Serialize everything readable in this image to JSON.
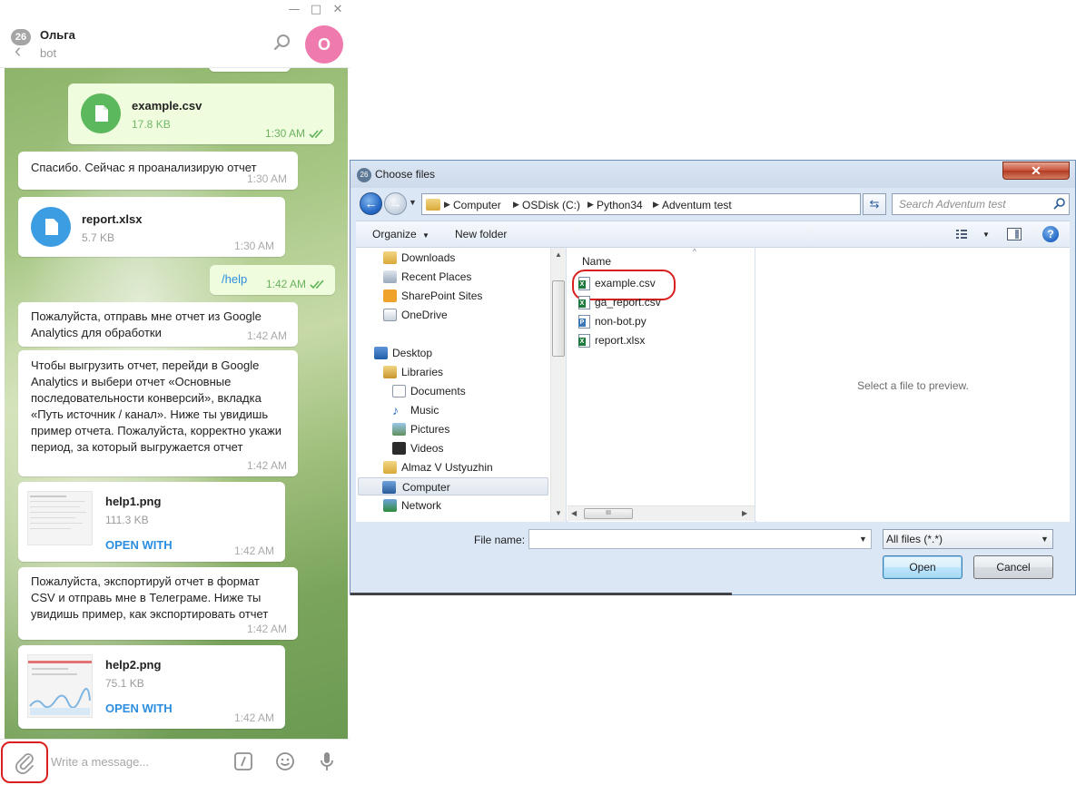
{
  "telegram": {
    "window_controls": {
      "minimize": "—",
      "maximize": "□",
      "close": "✕"
    },
    "header": {
      "unread_count": "26",
      "name": "Ольга",
      "subtitle": "bot",
      "avatar_letter": "О"
    },
    "messages": {
      "m1": {
        "file_name": "example.csv",
        "file_size": "17.8 KB",
        "time": "1:30 AM"
      },
      "m2": {
        "text": "Спасибо. Сейчас я проанализирую отчет",
        "time": "1:30 AM"
      },
      "m3": {
        "file_name": "report.xlsx",
        "file_size": "5.7 KB",
        "time": "1:30 AM"
      },
      "m4": {
        "text": "/help",
        "time": "1:42 AM"
      },
      "m5": {
        "text": "Пожалуйста, отправь мне отчет из Google Analytics для обработки",
        "time": "1:42 AM"
      },
      "m6": {
        "text": "Чтобы выгрузить отчет, перейди в Google Analytics и выбери отчет «Основные последовательности конверсий»,   вкладка «Путь источник / канал». Ниже ты увидишь пример отчета. Пожалуйста, корректно укажи период, за который выгружается отчет",
        "time": "1:42 AM"
      },
      "m7": {
        "file_name": "help1.png",
        "file_size": "111.3 KB",
        "action": "OPEN WITH",
        "time": "1:42 AM"
      },
      "m8": {
        "text": "Пожалуйста, экспортируй отчет в формат CSV и отправь мне в Телеграме. Ниже ты увидишь пример, как экспортировать отчет",
        "time": "1:42 AM"
      },
      "m9": {
        "file_name": "help2.png",
        "file_size": "75.1 KB",
        "action": "OPEN WITH",
        "time": "1:42 AM"
      }
    },
    "composer": {
      "placeholder": "Write a message..."
    },
    "colors": {
      "avatar": "#ee7aae",
      "link": "#2c8ee0",
      "highlight": "#d9201f"
    }
  },
  "dialog": {
    "title": "Choose files",
    "breadcrumbs": [
      "Computer",
      "OSDisk (C:)",
      "Python34",
      "Adventum test"
    ],
    "search_placeholder": "Search Adventum test",
    "toolbar": {
      "organize": "Organize",
      "new_folder": "New folder"
    },
    "nav": {
      "downloads": "Downloads",
      "recent_places": "Recent Places",
      "sharepoint": "SharePoint Sites",
      "onedrive": "OneDrive",
      "desktop": "Desktop",
      "libraries": "Libraries",
      "documents": "Documents",
      "music": "Music",
      "pictures": "Pictures",
      "videos": "Videos",
      "user": "Almaz V Ustyuzhin",
      "computer": "Computer",
      "network": "Network"
    },
    "column_header": "Name",
    "files": [
      "example.csv",
      "ga_report.csv",
      "non-bot.py",
      "report.xlsx"
    ],
    "scrollbar_grip": "III",
    "preview_text": "Select a file to preview.",
    "file_name_label": "File name:",
    "file_name_value": "",
    "filter": "All files (*.*)",
    "open_label": "Open",
    "cancel_label": "Cancel"
  }
}
